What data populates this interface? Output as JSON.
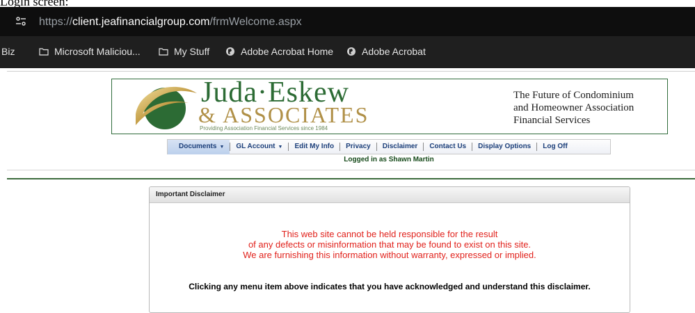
{
  "caption": "Login screen:",
  "browser": {
    "url_scheme": "https://",
    "url_host": "client.jeafinancialgroup.com",
    "url_path": "/frmWelcome.aspx",
    "bookmarks": [
      {
        "label": "Biz",
        "icon": "none"
      },
      {
        "label": "Microsoft Maliciou...",
        "icon": "folder-icon"
      },
      {
        "label": "My Stuff",
        "icon": "folder-icon"
      },
      {
        "label": "Adobe Acrobat Home",
        "icon": "globe-icon"
      },
      {
        "label": "Adobe Acrobat",
        "icon": "globe-icon"
      }
    ]
  },
  "banner": {
    "brand_line1": "Juda·Eskew",
    "brand_line2": "& ASSOCIATES",
    "brand_tag": "Providing Association Financial Services since 1984",
    "tagline": [
      "The Future of Condominium",
      "and Homeowner Association",
      "Financial Services"
    ]
  },
  "nav": {
    "items": [
      {
        "label": "Documents",
        "dropdown": true
      },
      {
        "label": "GL Account",
        "dropdown": true
      },
      {
        "label": "Edit My Info",
        "dropdown": false
      },
      {
        "label": "Privacy",
        "dropdown": false
      },
      {
        "label": "Disclaimer",
        "dropdown": false
      },
      {
        "label": "Contact Us",
        "dropdown": false
      },
      {
        "label": "Display Options",
        "dropdown": false
      },
      {
        "label": "Log Off",
        "dropdown": false
      }
    ],
    "caret": "▼",
    "logged_in": "Logged in as Shawn Martin"
  },
  "panel": {
    "title": "Important Disclaimer",
    "warning": [
      "This web site cannot be held responsible for the result",
      "of any defects or misinformation that may be found to exist on this site.",
      "We are furnishing this information without warranty, expressed or implied."
    ],
    "acknowledgement": "Clicking any menu item above indicates that you have acknowledged and understand this disclaimer."
  },
  "colors": {
    "brand_green": "#2c6b34",
    "brand_gold": "#b09047",
    "nav_text": "#1c3f7a",
    "warning_red": "#e1221c"
  }
}
